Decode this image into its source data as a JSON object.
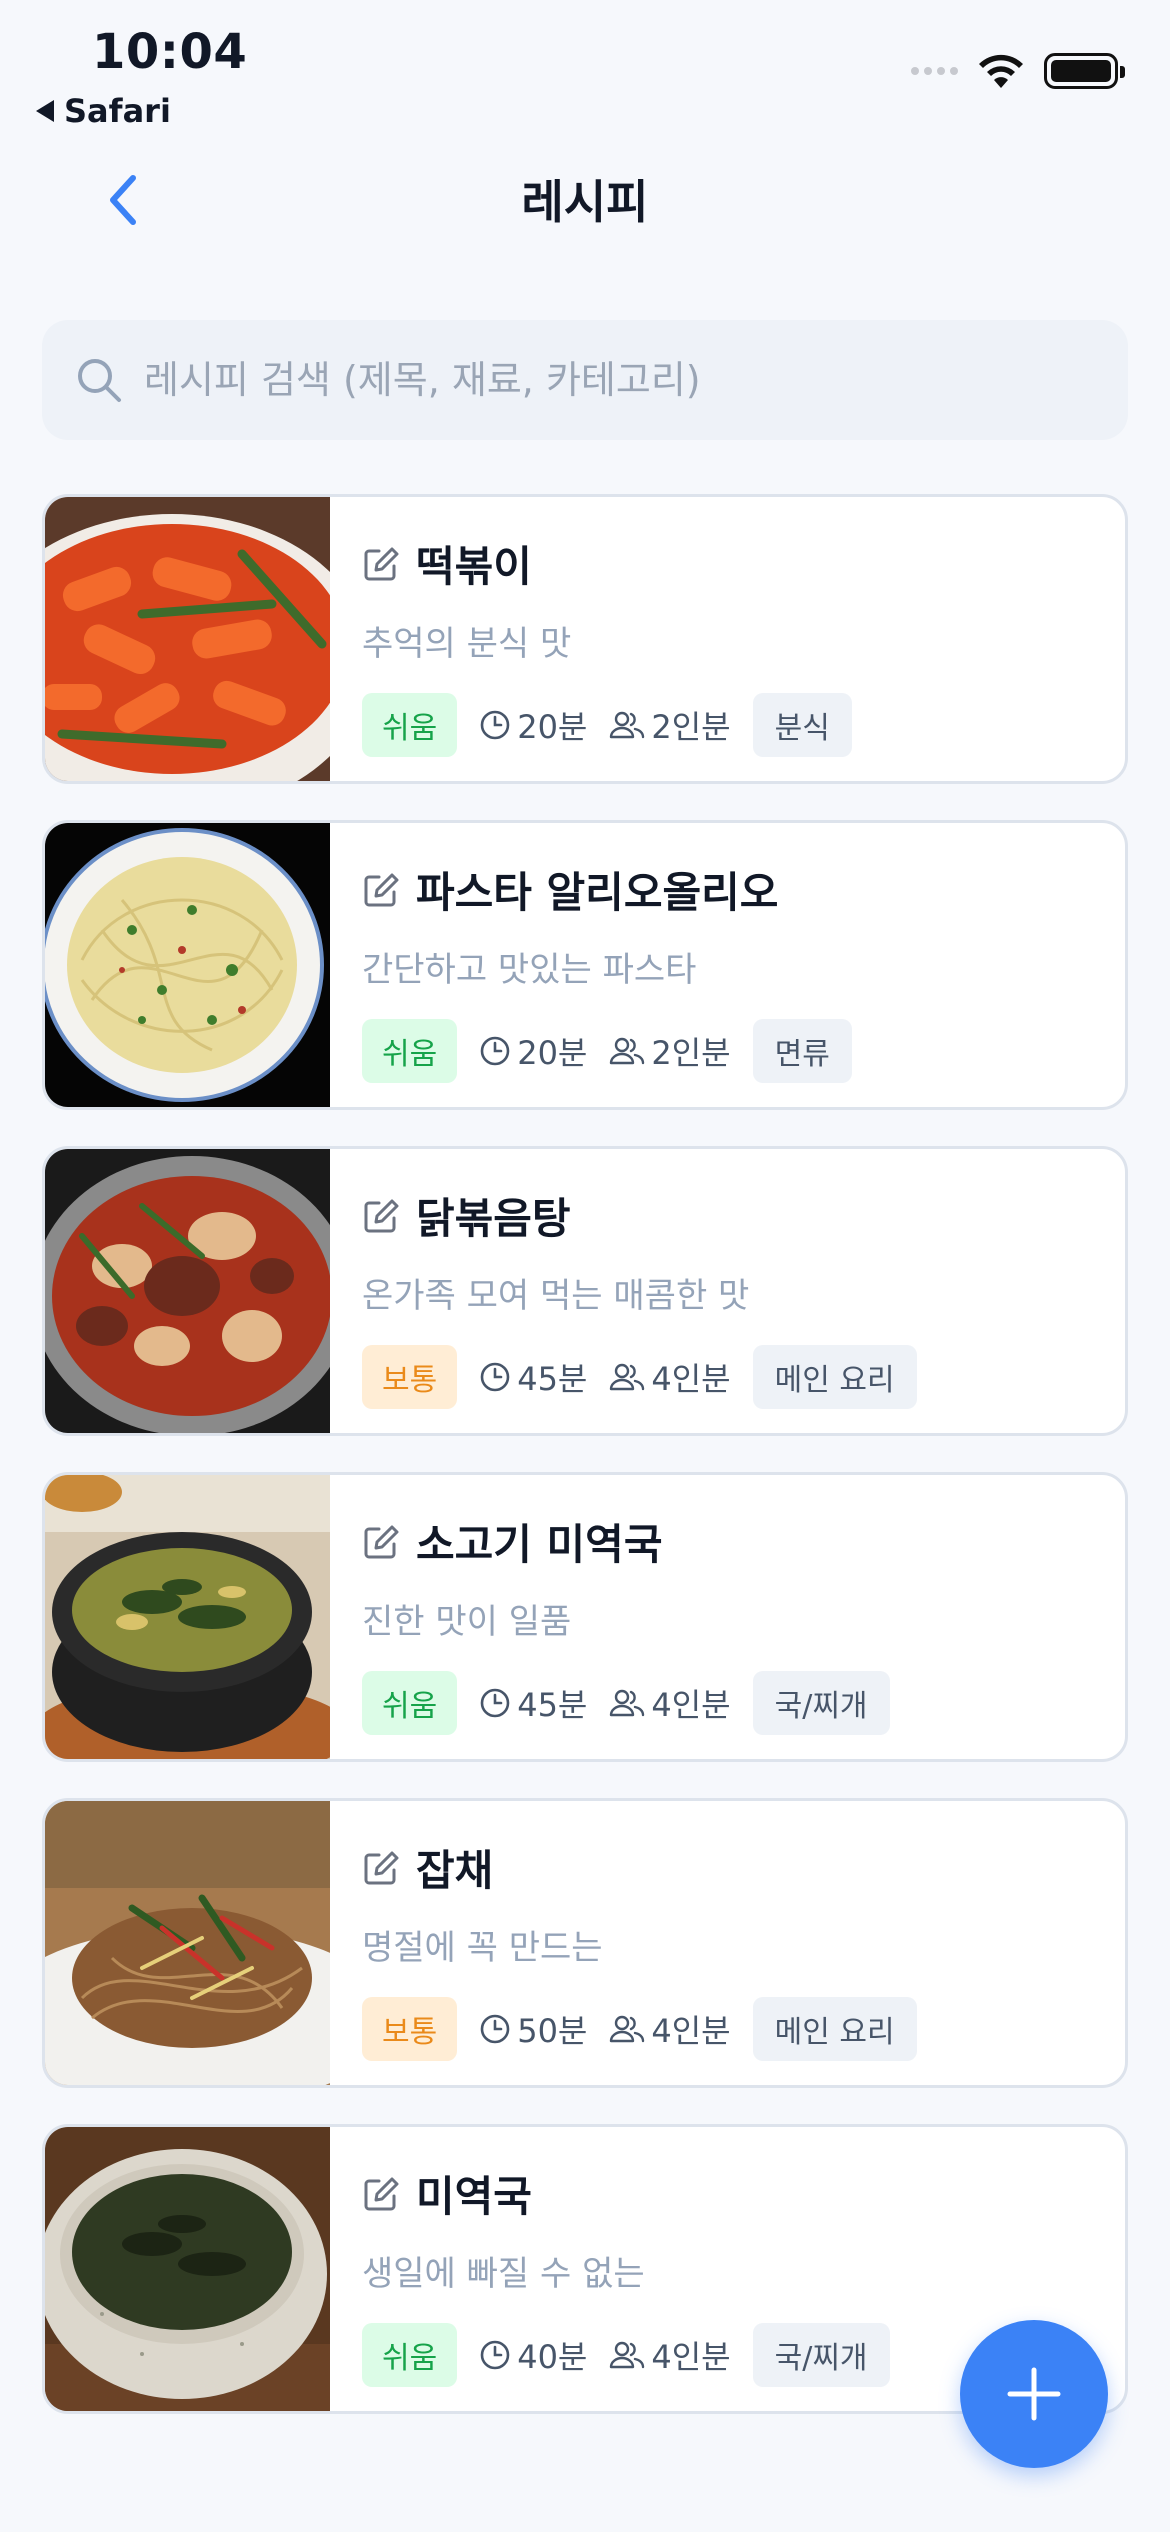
{
  "status_bar": {
    "time": "10:04",
    "back_app": "Safari"
  },
  "nav": {
    "title": "레시피"
  },
  "search": {
    "placeholder": "레시피 검색 (제목, 재료, 카테고리)"
  },
  "recipes": [
    {
      "title": "떡볶이",
      "description": "추억의 분식 맛",
      "difficulty": "쉬움",
      "difficulty_level": "easy",
      "time": "20분",
      "servings": "2인분",
      "category": "분식"
    },
    {
      "title": "파스타 알리오올리오",
      "description": "간단하고 맛있는 파스타",
      "difficulty": "쉬움",
      "difficulty_level": "easy",
      "time": "20분",
      "servings": "2인분",
      "category": "면류"
    },
    {
      "title": "닭볶음탕",
      "description": "온가족 모여 먹는 매콤한 맛",
      "difficulty": "보통",
      "difficulty_level": "medium",
      "time": "45분",
      "servings": "4인분",
      "category": "메인 요리"
    },
    {
      "title": "소고기 미역국",
      "description": "진한 맛이 일품",
      "difficulty": "쉬움",
      "difficulty_level": "easy",
      "time": "45분",
      "servings": "4인분",
      "category": "국/찌개"
    },
    {
      "title": "잡채",
      "description": "명절에 꼭 만드는",
      "difficulty": "보통",
      "difficulty_level": "medium",
      "time": "50분",
      "servings": "4인분",
      "category": "메인 요리"
    },
    {
      "title": "미역국",
      "description": "생일에 빠질 수 없는",
      "difficulty": "쉬움",
      "difficulty_level": "easy",
      "time": "40분",
      "servings": "4인분",
      "category": "국/찌개"
    }
  ],
  "colors": {
    "accent": "#3b82f6",
    "easy": "#16a34a",
    "medium": "#ea8a1a"
  },
  "icons": {
    "back": "chevron-left-icon",
    "search": "search-icon",
    "edit": "edit-icon",
    "time": "clock-icon",
    "servings": "users-icon",
    "fab": "plus-icon"
  }
}
